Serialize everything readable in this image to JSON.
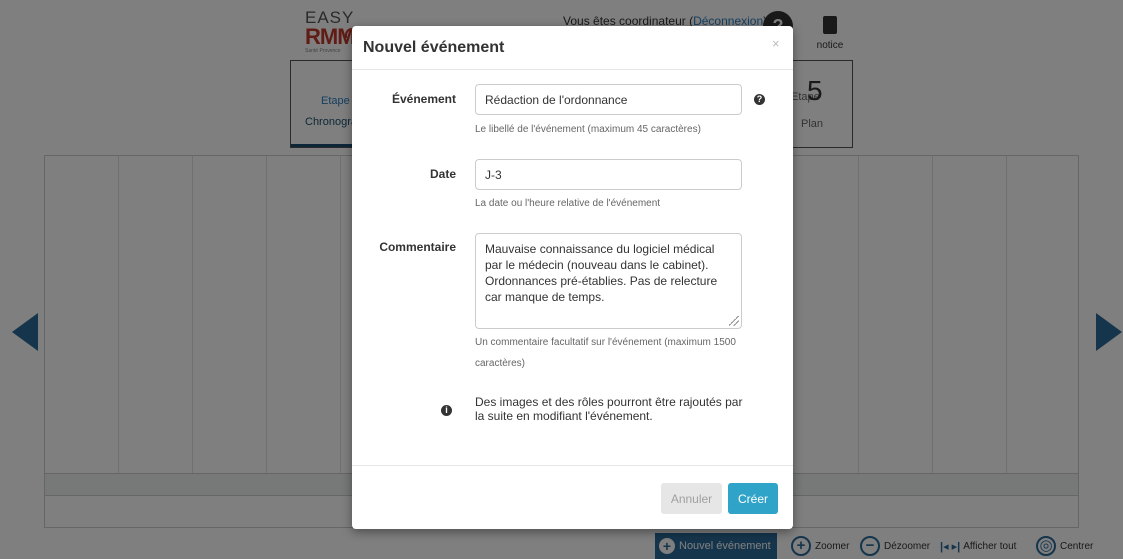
{
  "header": {
    "logo_top": "EASY",
    "logo_main": "RMM",
    "logo_sub": "Santé Provence",
    "coordinator_text": "Vous êtes coordinateur (",
    "logout_link": "Déconnexion",
    "coordinator_text_end": ")",
    "help_label": "?",
    "notice_label": "notice"
  },
  "steps": {
    "step1_label": "Etape",
    "step1_name": "Chronogramme",
    "step5_number": "5",
    "step5_label": "Etape",
    "step5_name": "Plan"
  },
  "footer": {
    "new_event": "Nouvel événement",
    "zoom_in": "Zoomer",
    "zoom_out": "Dézoomer",
    "show_all": "Afficher tout",
    "center": "Centrer"
  },
  "modal": {
    "title": "Nouvel événement",
    "close": "×",
    "event": {
      "label": "Événement",
      "value": "Rédaction de l'ordonnance",
      "help": "Le libellé de l'événement (maximum 45 caractères)"
    },
    "date": {
      "label": "Date",
      "value": "J-3",
      "help": "La date ou l'heure relative de l'événement"
    },
    "comment": {
      "label": "Commentaire",
      "value": "Mauvaise connaissance du logiciel médical par le médecin (nouveau dans le cabinet). Ordonnances pré-établies. Pas de relecture car manque de temps.",
      "help": "Un commentaire facultatif sur l'événement (maximum 1500 caractères)"
    },
    "info": "Des images et des rôles pourront être rajoutés par la suite en modifiant l'événement.",
    "cancel": "Annuler",
    "create": "Créer"
  },
  "colors": {
    "primary": "#2b6a99",
    "create_button": "#2fa4c8",
    "logo_red": "#c0392b"
  }
}
